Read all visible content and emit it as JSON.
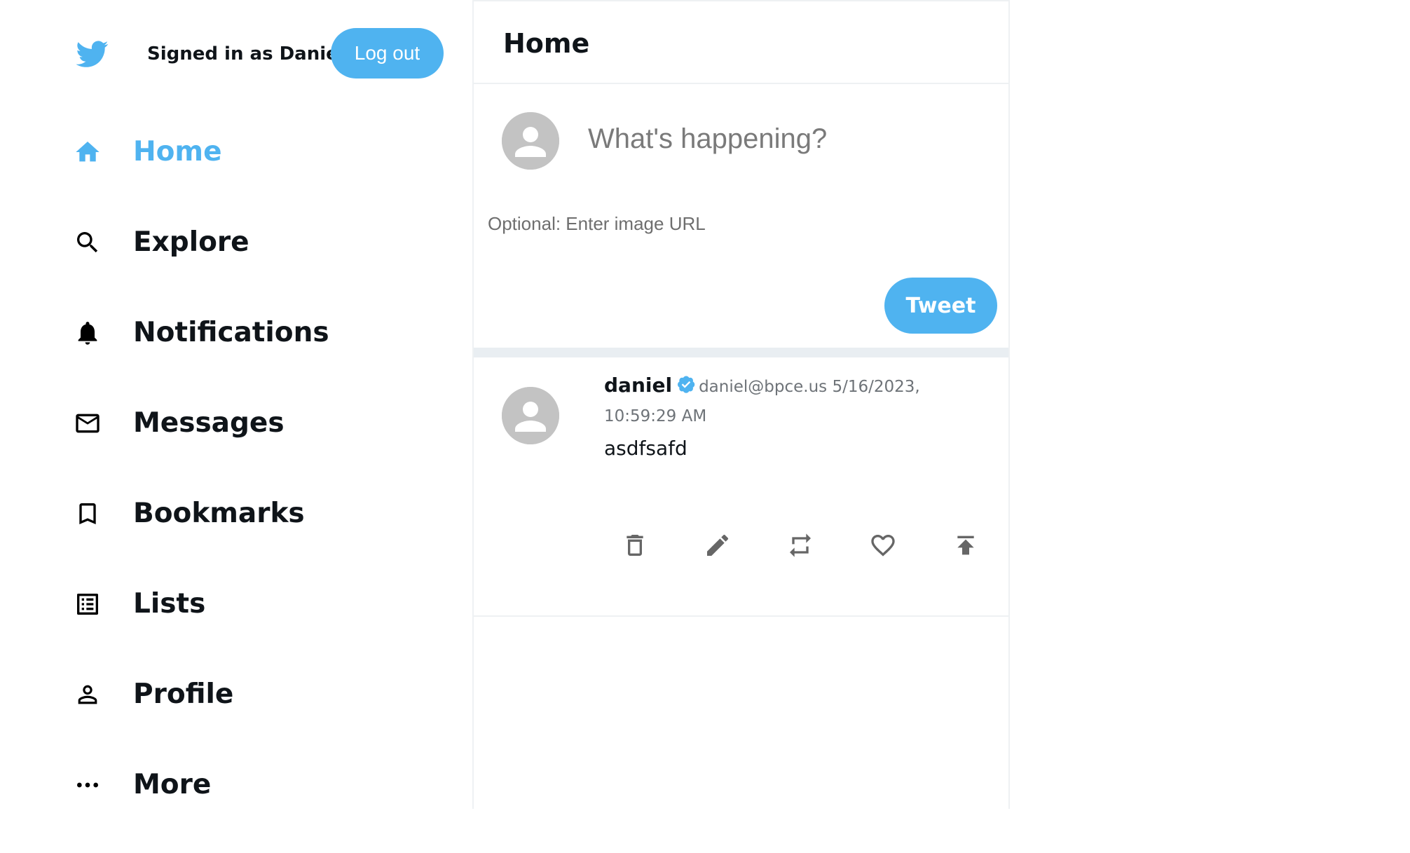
{
  "header": {
    "signed_in_text": "Signed in as Daniel",
    "logout_label": "Log out"
  },
  "sidebar": {
    "items": [
      {
        "label": "Home",
        "icon": "home-icon",
        "active": true
      },
      {
        "label": "Explore",
        "icon": "search-icon"
      },
      {
        "label": "Notifications",
        "icon": "bell-icon"
      },
      {
        "label": "Messages",
        "icon": "mail-icon"
      },
      {
        "label": "Bookmarks",
        "icon": "bookmark-icon"
      },
      {
        "label": "Lists",
        "icon": "list-icon"
      },
      {
        "label": "Profile",
        "icon": "person-icon"
      },
      {
        "label": "More",
        "icon": "more-icon"
      }
    ]
  },
  "main": {
    "title": "Home",
    "composer": {
      "placeholder": "What's happening?",
      "image_placeholder": "Optional: Enter image URL",
      "tweet_label": "Tweet"
    },
    "tweets": [
      {
        "name": "daniel",
        "verified": true,
        "meta": "daniel@bpce.us 5/16/2023, 10:59:29 AM",
        "text": "asdfsafd",
        "actions": [
          "delete-icon",
          "edit-icon",
          "retweet-icon",
          "like-icon",
          "pin-icon"
        ]
      }
    ]
  },
  "colors": {
    "accent": "#4fb3f0",
    "text": "#0f1419",
    "muted": "#6e7378",
    "border": "#eef1f3",
    "avatar": "#c3c3c3"
  }
}
